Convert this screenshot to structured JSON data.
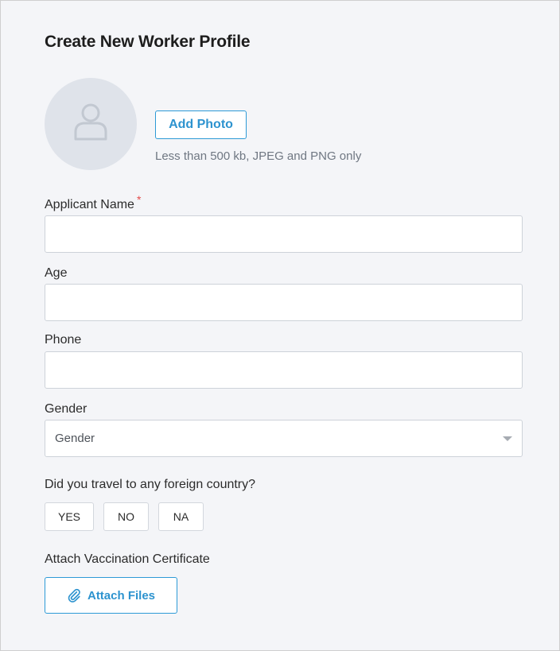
{
  "form": {
    "title": "Create New Worker Profile",
    "photo": {
      "avatar_icon": "user-icon",
      "add_photo_label": "Add Photo",
      "hint": "Less than 500 kb, JPEG and PNG only"
    },
    "fields": {
      "applicant_name": {
        "label": "Applicant Name",
        "required_mark": "*",
        "value": ""
      },
      "age": {
        "label": "Age",
        "value": ""
      },
      "phone": {
        "label": "Phone",
        "value": ""
      },
      "gender": {
        "label": "Gender",
        "selected": "Gender"
      }
    },
    "travel": {
      "question": "Did you travel to any foreign country?",
      "options": [
        "YES",
        "NO",
        "NA"
      ]
    },
    "attachment": {
      "label": "Attach Vaccination Certificate",
      "button_label": "Attach Files",
      "icon": "paperclip-icon"
    }
  },
  "colors": {
    "accent": "#2d93cf",
    "background": "#f4f5f8",
    "required": "#e34b4b"
  }
}
